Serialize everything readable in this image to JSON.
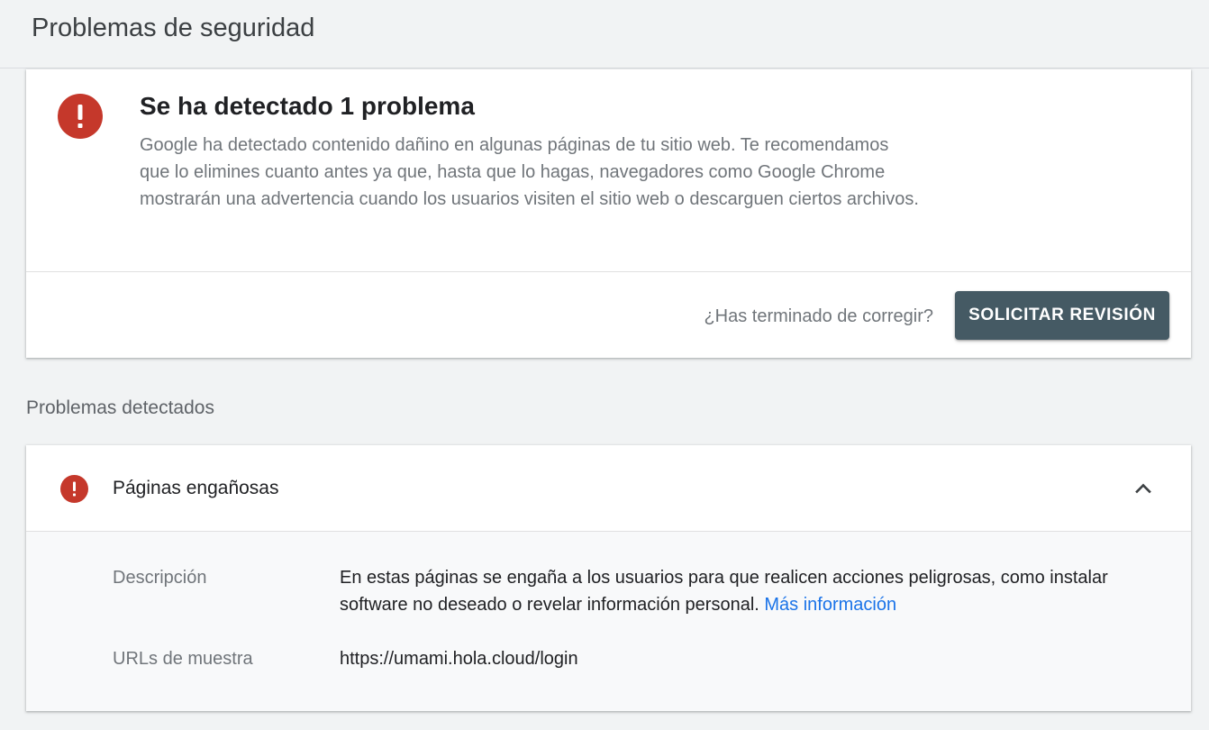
{
  "header": {
    "title": "Problemas de seguridad"
  },
  "summary": {
    "heading": "Se ha detectado 1 problema",
    "text": "Google ha detectado contenido dañino en algunas páginas de tu sitio web. Te recomendamos que lo elimines cuanto antes ya que, hasta que lo hagas, navegadores como Google Chrome mostrarán una advertencia cuando los usuarios visiten el sitio web o descarguen ciertos archivos.",
    "question": "¿Has terminado de corregir?",
    "request_review_label": "SOLICITAR REVISIÓN",
    "icon": "error-icon"
  },
  "detected": {
    "section_label": "Problemas detectados",
    "issues": [
      {
        "title": "Páginas engañosas",
        "icon": "error-icon",
        "expanded": true,
        "description_label": "Descripción",
        "description_text": "En estas páginas se engaña a los usuarios para que realicen acciones peligrosas, como instalar software no deseado o revelar información personal.",
        "learn_more_label": "Más información",
        "sample_urls_label": "URLs de muestra",
        "sample_urls": [
          "https://umami.hola.cloud/login"
        ]
      }
    ]
  },
  "colors": {
    "error": "#c5382b",
    "button": "#455a64",
    "link": "#1a73e8",
    "background": "#f1f3f4"
  }
}
